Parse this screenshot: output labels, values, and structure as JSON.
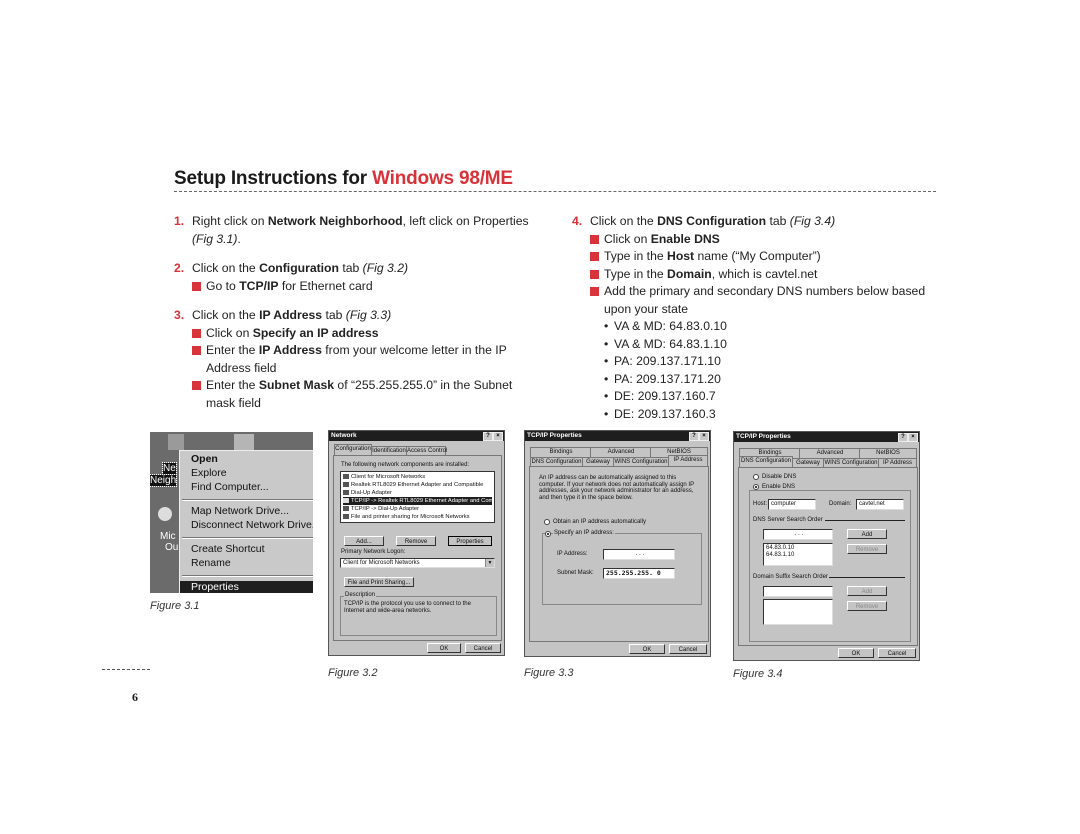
{
  "header": {
    "title_prefix": "Setup Instructions for ",
    "title_accent": "Windows 98/ME"
  },
  "colors": {
    "accent": "#d8333a",
    "text": "#222222"
  },
  "steps_left": [
    {
      "num": "1.",
      "parts": {
        "a": "Right click on ",
        "b": "Network Neighborhood",
        "c": ", left click on Properties ",
        "fig": "(Fig 3.1)",
        "d": "."
      }
    },
    {
      "num": "2.",
      "parts": {
        "a": "Click on the ",
        "b": "Configuration",
        "c": " tab ",
        "fig": "(Fig 3.2)"
      },
      "bullets": [
        {
          "a": "Go to ",
          "b": "TCP/IP",
          "c": " for Ethernet card"
        }
      ]
    },
    {
      "num": "3.",
      "parts": {
        "a": "Click on the ",
        "b": "IP Address",
        "c": " tab ",
        "fig": "(Fig 3.3)"
      },
      "bullets": [
        {
          "a": "Click on ",
          "b": "Specify an IP address",
          "c": ""
        },
        {
          "a": "Enter the ",
          "b": "IP Address",
          "c": " from your welcome letter in the IP Address field"
        },
        {
          "a": "Enter the ",
          "b": "Subnet Mask",
          "c": " of “255.255.255.0” in the Subnet mask field"
        }
      ]
    }
  ],
  "steps_right": [
    {
      "num": "4.",
      "parts": {
        "a": "Click on the ",
        "b": "DNS Configuration",
        "c": " tab ",
        "fig": "(Fig 3.4)"
      },
      "bullets": [
        {
          "a": "Click on ",
          "b": "Enable DNS",
          "c": ""
        },
        {
          "a": "Type in the ",
          "b": "Host",
          "c": " name (“My Computer”)"
        },
        {
          "a": "Type in the ",
          "b": "Domain",
          "c": ", which is cavtel.net"
        },
        {
          "a": "Add the primary and secondary DNS numbers below based",
          "b": "",
          "c": ""
        }
      ],
      "continuation": "upon your state",
      "dns_list": [
        "VA & MD: 64.83.0.10",
        "VA & MD: 64.83.1.10",
        "PA: 209.137.171.10",
        "PA: 209.137.171.20",
        "DE: 209.137.160.7",
        "DE: 209.137.160.3"
      ]
    }
  ],
  "figures": {
    "fig1": {
      "caption": "Figure 3.1",
      "desktop_labels": [
        "Ne",
        "Neigh",
        "Mic",
        "Ou"
      ],
      "menu": [
        "Open",
        "Explore",
        "Find Computer...",
        "Map Network Drive...",
        "Disconnect Network Drive...",
        "Create Shortcut",
        "Rename",
        "Properties"
      ]
    },
    "fig2": {
      "caption": "Figure 3.2",
      "title": "Network",
      "help": "?",
      "close": "×",
      "tabs": [
        "Configuration",
        "Identification",
        "Access Control"
      ],
      "list_label": "The following network components are installed:",
      "components": [
        "Client for Microsoft Networks",
        "Realtek RTL8029 Ethernet Adapter and Compatible",
        "Dial-Up Adapter",
        "TCP/IP -> Realtek RTL8029 Ethernet Adapter and Compatib",
        "TCP/IP -> Dial-Up Adapter",
        "File and printer sharing for Microsoft Networks"
      ],
      "selected_index": 3,
      "buttons": [
        "Add...",
        "Remove",
        "Properties"
      ],
      "logon_label": "Primary Network Logon:",
      "logon_value": "Client for Microsoft Networks",
      "file_print_btn": "File and Print Sharing...",
      "desc_label": "Description",
      "desc_text": "TCP/IP is the protocol you use to connect to the Internet and wide-area networks.",
      "ok": "OK",
      "cancel": "Cancel"
    },
    "fig3": {
      "caption": "Figure 3.3",
      "title": "TCP/IP Properties",
      "help": "?",
      "close": "×",
      "tabs_row1": [
        "Bindings",
        "Advanced",
        "NetBIOS"
      ],
      "tabs_row2": [
        "DNS Configuration",
        "Gateway",
        "WINS Configuration",
        "IP Address"
      ],
      "intro": "An IP address can be automatically assigned to this computer. If your network does not automatically assign IP addresses, ask your network administrator for an address, and then type it in the space below.",
      "radio_auto": "Obtain an IP address automatically",
      "radio_specify": "Specify an IP address:",
      "ip_label": "IP Address:",
      "ip_value": " .   .   . ",
      "mask_label": "Subnet Mask:",
      "mask_value": "255.255.255. 0",
      "ok": "OK",
      "cancel": "Cancel"
    },
    "fig4": {
      "caption": "Figure 3.4",
      "title": "TCP/IP Properties",
      "help": "?",
      "close": "×",
      "tabs_row1": [
        "Bindings",
        "Advanced",
        "NetBIOS"
      ],
      "tabs_row2": [
        "DNS Configuration",
        "Gateway",
        "WINS Configuration",
        "IP Address"
      ],
      "radio_disable": "Disable DNS",
      "radio_enable": "Enable DNS",
      "host_label": "Host:",
      "host_value": "computer",
      "domain_label": "Domain:",
      "domain_value": "cavtel.net",
      "dns_order_label": "DNS Server Search Order",
      "dns_input": " .   .   . ",
      "dns_entries": [
        "64.83.0.10",
        "64.83.1.10"
      ],
      "suffix_label": "Domain Suffix Search Order",
      "add": "Add",
      "remove": "Remove",
      "ok": "OK",
      "cancel": "Cancel"
    }
  },
  "footer": {
    "page_number": "6"
  }
}
